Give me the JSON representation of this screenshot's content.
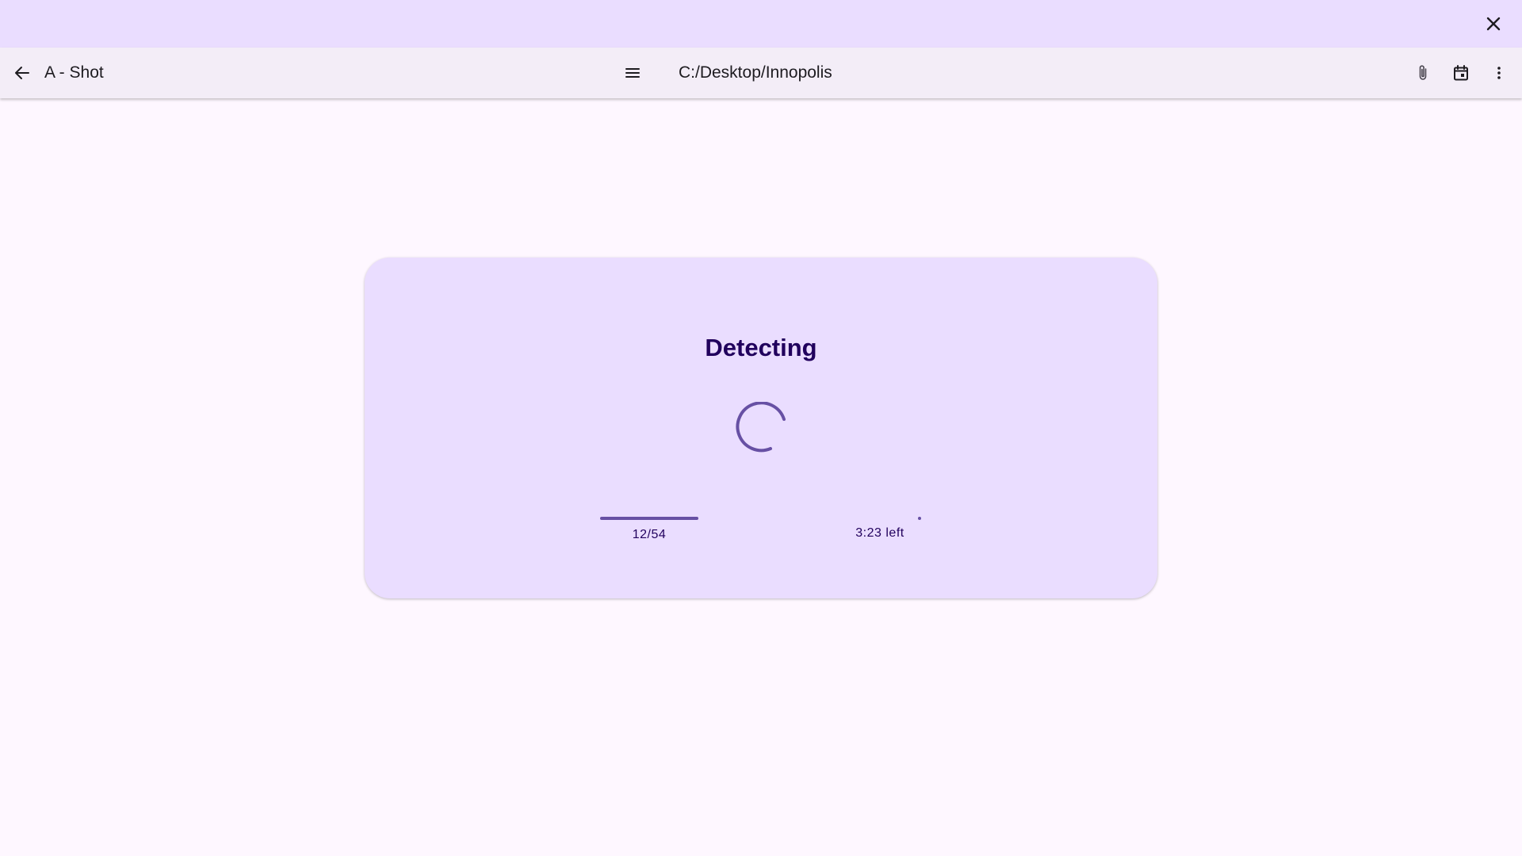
{
  "window": {
    "close_icon": "close-icon"
  },
  "appbar": {
    "back_icon": "arrow-back-icon",
    "title": "A - Shot",
    "menu_icon": "hamburger-menu-icon",
    "path": "C:/Desktop/Innopolis",
    "attach_icon": "paperclip-icon",
    "calendar_icon": "calendar-icon",
    "more_icon": "more-vertical-icon"
  },
  "card": {
    "title": "Detecting",
    "progress": {
      "current": 12,
      "total": 54,
      "label": "12/54"
    },
    "time_left": "3:23 left"
  },
  "colors": {
    "titlebar_bg": "#eaddff",
    "appbar_bg": "#f3edf7",
    "page_bg": "#fef7ff",
    "card_bg": "#eaddff",
    "accent": "#6750a4",
    "title_text": "#21005d"
  }
}
